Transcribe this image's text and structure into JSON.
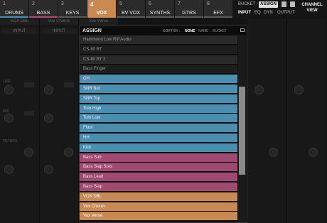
{
  "tabs": [
    {
      "num": "1",
      "label": "DRUMS",
      "bar": "#4a90b0",
      "active": false
    },
    {
      "num": "2",
      "label": "BASS",
      "bar": "#b04a7a",
      "active": false
    },
    {
      "num": "3",
      "label": "KEYS",
      "bar": "#5a5a5a",
      "active": false
    },
    {
      "num": "4",
      "label": "VOX",
      "bar": "#c98a52",
      "active": true
    },
    {
      "num": "5",
      "label": "BV VOX",
      "bar": "#5a5a5a",
      "active": false
    },
    {
      "num": "6",
      "label": "SYNTHS",
      "bar": "#5a5a5a",
      "active": false
    },
    {
      "num": "7",
      "label": "GTRS",
      "bar": "#5a5a5a",
      "active": false
    },
    {
      "num": "8",
      "label": "EFX",
      "bar": "#5a5a5a",
      "active": false
    }
  ],
  "controls": {
    "bucket": "BUCKET -",
    "assign": "ASSIGN",
    "input": "INPUT",
    "eq": "EQ",
    "dyn": "DYN",
    "output": "OUTPUT",
    "channel_view_1": "CHANNEL",
    "channel_view_2": "VIEW"
  },
  "strips": {
    "names": [
      "VOX DBL",
      "Vox Chorus",
      "Vox Verse"
    ],
    "input_label": "INPUT",
    "line": "LINE",
    "mic": "MIC",
    "filters": "FILTERS"
  },
  "modal": {
    "title": "ASSIGN",
    "sort_by": "SORT BY :",
    "sort_options": [
      "NONE",
      "NAME",
      "BUCKET"
    ],
    "sort_selected": "NONE",
    "items": [
      {
        "label": "Hammond Low Riff Audio",
        "color": "#2a2a2a",
        "text": "#9a9a9a"
      },
      {
        "label": "CS-80 RT",
        "color": "#1e1e1e",
        "text": "#9a9a9a"
      },
      {
        "label": "CS-80 RT 2",
        "color": "#2a2a2a",
        "text": "#9a9a9a"
      },
      {
        "label": "Bass Finger",
        "color": "#1e1e1e",
        "text": "#9a9a9a"
      },
      {
        "label": "OH",
        "color": "#4a8fb0",
        "text": "#eef"
      },
      {
        "label": "SNR Bot",
        "color": "#4a8fb0",
        "text": "#eef"
      },
      {
        "label": "SNR Top",
        "color": "#4a8fb0",
        "text": "#eef"
      },
      {
        "label": "Tom High",
        "color": "#4a8fb0",
        "text": "#eef"
      },
      {
        "label": "Tom Low",
        "color": "#4a8fb0",
        "text": "#eef"
      },
      {
        "label": "Floor",
        "color": "#4a8fb0",
        "text": "#eef"
      },
      {
        "label": "HH",
        "color": "#4a8fb0",
        "text": "#eef"
      },
      {
        "label": "Kick",
        "color": "#4a8fb0",
        "text": "#eef"
      },
      {
        "label": "Bass Sub",
        "color": "#a04a72",
        "text": "#fde"
      },
      {
        "label": "Bass Slap Solo",
        "color": "#a04a72",
        "text": "#fde"
      },
      {
        "label": "Bass Lead",
        "color": "#a04a72",
        "text": "#fde"
      },
      {
        "label": "Bass Slap",
        "color": "#a04a72",
        "text": "#fde"
      },
      {
        "label": "VOX DBL",
        "color": "#c98a52",
        "text": "#fff"
      },
      {
        "label": "Vox Chorus",
        "color": "#c98a52",
        "text": "#fff"
      },
      {
        "label": "Vox Verse",
        "color": "#c98a52",
        "text": "#fff"
      }
    ]
  }
}
